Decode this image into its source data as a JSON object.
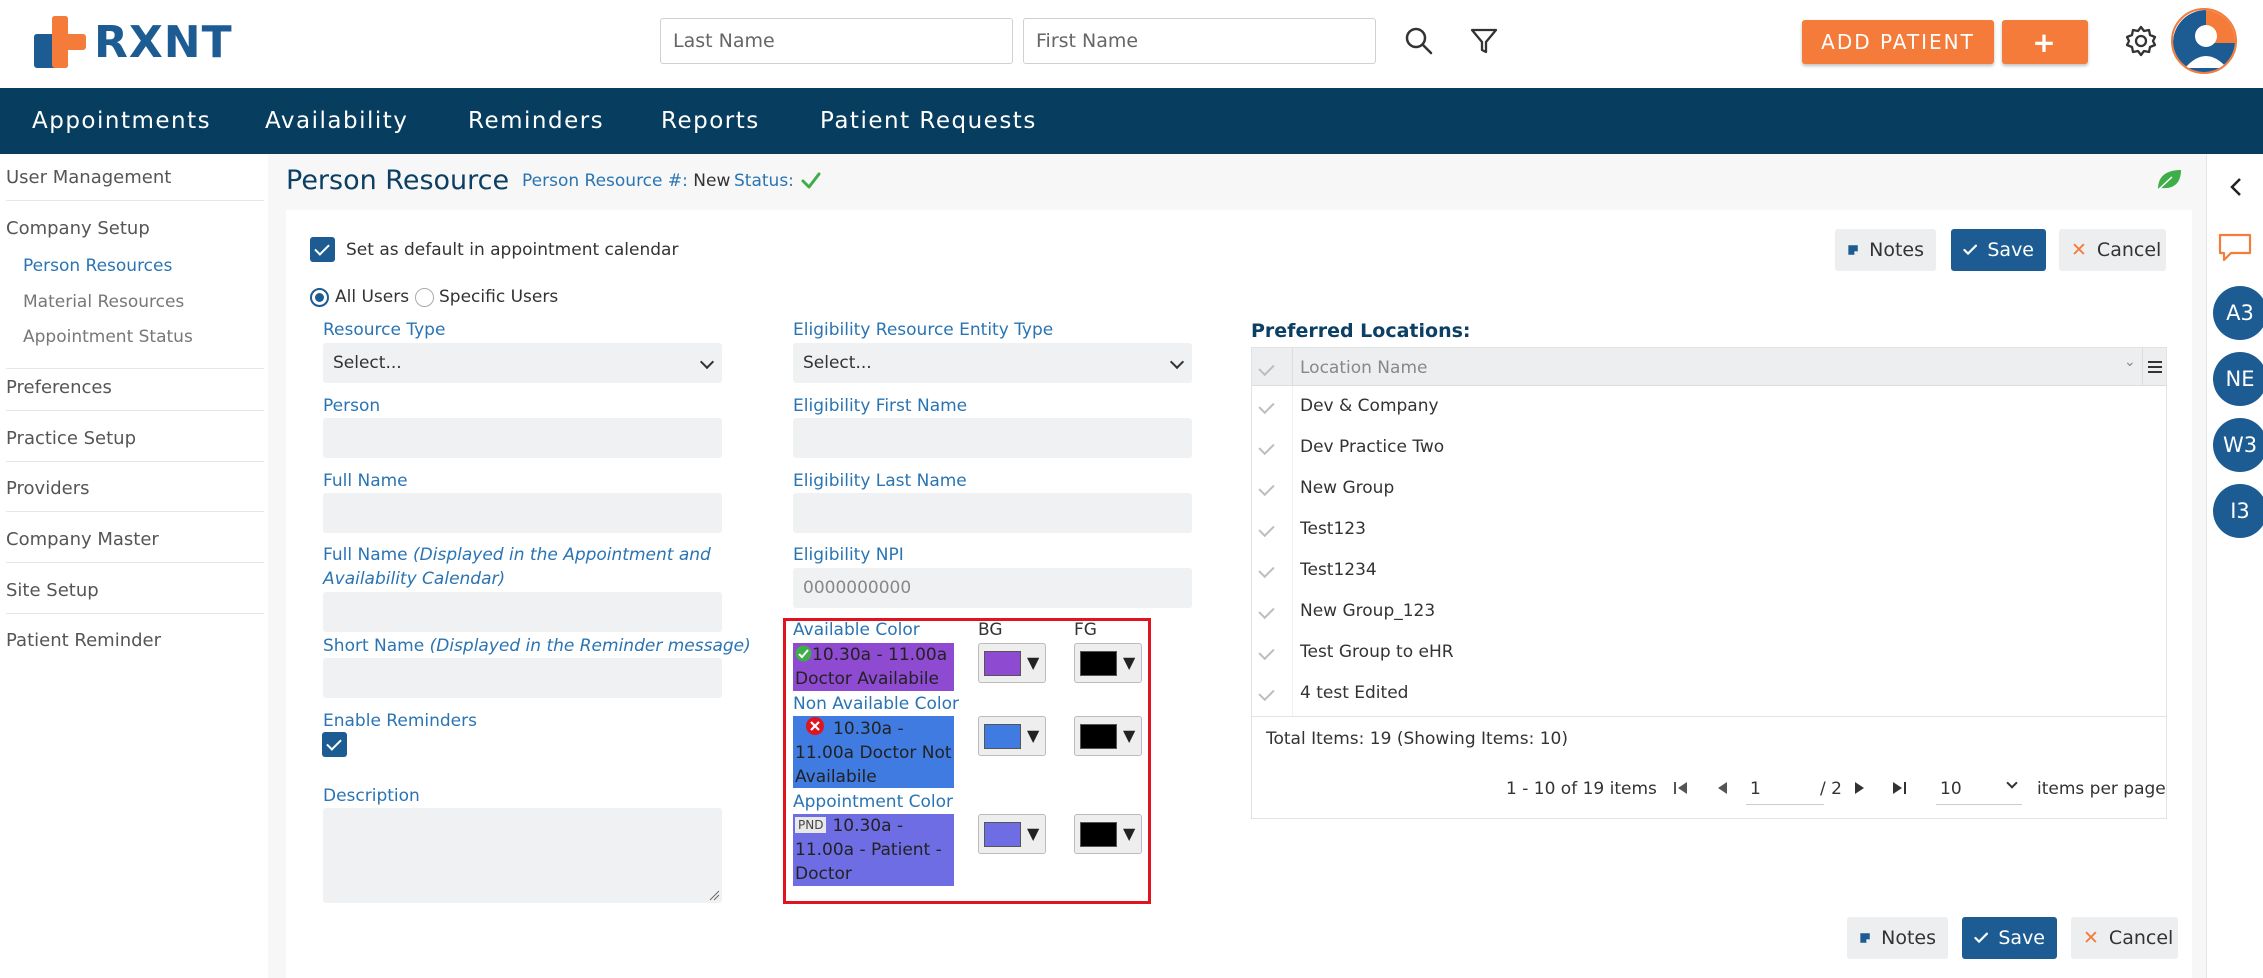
{
  "header": {
    "logo_text": "RXNT",
    "last_name_placeholder": "Last Name",
    "first_name_placeholder": "First Name",
    "add_patient_label": "ADD PATIENT",
    "add_plus_label": "+"
  },
  "nav": {
    "items": [
      "Appointments",
      "Availability",
      "Reminders",
      "Reports",
      "Patient Requests"
    ]
  },
  "sidebar": {
    "items": [
      "User Management",
      "Company Setup",
      "Preferences",
      "Practice Setup",
      "Providers",
      "Company Master",
      "Site Setup",
      "Patient Reminder"
    ],
    "sub_items": [
      "Person Resources",
      "Material Resources",
      "Appointment Status"
    ]
  },
  "page": {
    "title": "Person Resource",
    "number_label": "Person Resource #:",
    "number_value": "New",
    "status_label": "Status:"
  },
  "form": {
    "default_checkbox_label": "Set as default in appointment calendar",
    "radio_all": "All Users",
    "radio_specific": "Specific Users",
    "resource_type_label": "Resource Type",
    "resource_type_value": "Select...",
    "eligibility_entity_label": "Eligibility Resource Entity Type",
    "eligibility_entity_value": "Select...",
    "person_label": "Person",
    "elig_first_label": "Eligibility First Name",
    "full_name_label": "Full Name",
    "elig_last_label": "Eligibility Last Name",
    "full_name_cal_label": "Full Name",
    "full_name_cal_note": "(Displayed in the Appointment and Availability Calendar)",
    "elig_npi_label": "Eligibility NPI",
    "elig_npi_placeholder": "0000000000",
    "short_name_label": "Short Name",
    "short_name_note": "(Displayed in the Reminder message)",
    "enable_reminders_label": "Enable Reminders",
    "description_label": "Description"
  },
  "colors": {
    "bg_header": "BG",
    "fg_header": "FG",
    "available_label": "Available Color",
    "available_text": "10.30a - 11.00a Doctor Availabile",
    "available_bg": "#8e4ad1",
    "non_available_label": "Non Available Color",
    "non_available_text": "10.30a - 11.00a Doctor Not Availabile",
    "non_available_bg": "#3f7be0",
    "appointment_label": "Appointment Color",
    "appointment_badge": "PND",
    "appointment_text": "10.30a - 11.00a - Patient - Doctor",
    "appointment_bg": "#6f6de3",
    "fg_color": "#000000"
  },
  "actions": {
    "notes_label": "Notes",
    "save_label": "Save",
    "cancel_label": "Cancel"
  },
  "grid": {
    "title": "Preferred Locations:",
    "column": "Location Name",
    "rows": [
      "Dev & Company",
      "Dev Practice Two",
      "New Group",
      "Test123",
      "Test1234",
      "New Group_123",
      "Test Group to eHR",
      "4 test Edited"
    ],
    "total": "Total Items: 19 (Showing Items: 10)",
    "range": "1 - 10 of 19 items",
    "page": "1",
    "pages": "/ 2",
    "page_size": "10",
    "per_page": "items per page"
  },
  "rail": {
    "badges": [
      "A3",
      "NE",
      "W3",
      "I3"
    ]
  }
}
